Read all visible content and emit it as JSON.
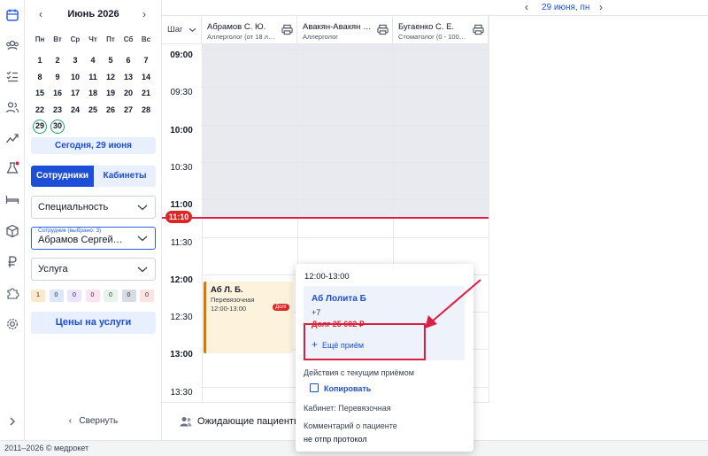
{
  "sidebar_icons": [
    "calendar-icon",
    "team-icon",
    "checklist-icon",
    "users-icon",
    "chart-icon",
    "lab-icon",
    "bed-icon",
    "box-icon",
    "ruble-icon",
    "puzzle-icon",
    "gear-icon",
    "expand-icon"
  ],
  "calendar": {
    "month_title": "Июнь 2026",
    "prev": "‹",
    "next": "›",
    "weekdays": [
      "Пн",
      "Вт",
      "Ср",
      "Чт",
      "Пт",
      "Сб",
      "Вс"
    ],
    "weeks": [
      [
        "1",
        "2",
        "3",
        "4",
        "5",
        "6",
        "7"
      ],
      [
        "8",
        "9",
        "10",
        "11",
        "12",
        "13",
        "14"
      ],
      [
        "15",
        "16",
        "17",
        "18",
        "19",
        "20",
        "21"
      ],
      [
        "22",
        "23",
        "24",
        "25",
        "26",
        "27",
        "28"
      ],
      [
        "29",
        "30",
        "",
        "",
        "",
        "",
        ""
      ]
    ],
    "today_button": "Сегодня, 29 июня"
  },
  "filters": {
    "tab_employees": "Сотрудники",
    "tab_rooms": "Кабинеты",
    "specialty": "Специальность",
    "employee_label": "Сотрудник (выбрано: 3)",
    "employee_value": "Абрамов Сергей…",
    "service": "Услуга",
    "counters": [
      "1",
      "0",
      "0",
      "0",
      "0",
      "0",
      "0"
    ],
    "counter_colors": [
      "#fde8cc",
      "#dbe7fb",
      "#ede3fb",
      "#fbe3ef",
      "#e6f4ea",
      "#d8dbe2",
      "#fde2e2"
    ],
    "prices_button": "Цены на услуги",
    "collapse": "Свернуть"
  },
  "datebar": {
    "date": "29 июня, пн",
    "prev": "‹",
    "next": "›"
  },
  "grid": {
    "step_label": "Шаг",
    "columns": [
      {
        "name": "Абрамов С. Ю.",
        "spec": "Аллерголог (от 18 л…"
      },
      {
        "name": "Авакян-Авакян …",
        "spec": "Аллерголог"
      },
      {
        "name": "Бугаенко С. Е.",
        "spec": "Стоматолог (0 - 100…"
      }
    ],
    "times": [
      "09:00",
      "09:30",
      "10:00",
      "10:30",
      "11:00",
      "11:30",
      "12:00",
      "12:30",
      "13:00",
      "13:30"
    ],
    "now": "11:10",
    "appointment": {
      "name": "Аб Л. Б.",
      "room": "Перевязочная",
      "time": "12:00-13:00",
      "debt_badge": "Долг"
    }
  },
  "waiting": {
    "label": "Ожидающие пациенты"
  },
  "popover": {
    "time": "12:00-13:00",
    "patient": "Аб Лолита Б",
    "extra": "+7",
    "debt": "Долг 25 602 ₽",
    "more": "Ещё приём",
    "actions_title": "Действия с текущим приёмом",
    "copy": "Копировать",
    "room": "Кабинет: Перевязочная",
    "comment_title": "Комментарий о пациенте",
    "comment": "не отпр протокол"
  },
  "footer": {
    "copyright": "2011–2026 © медрокет"
  },
  "colors": {
    "accent": "#1d4ed8",
    "now_line": "#e11d48",
    "highlight": "#dc1e44",
    "appointment_border": "#d97706"
  }
}
